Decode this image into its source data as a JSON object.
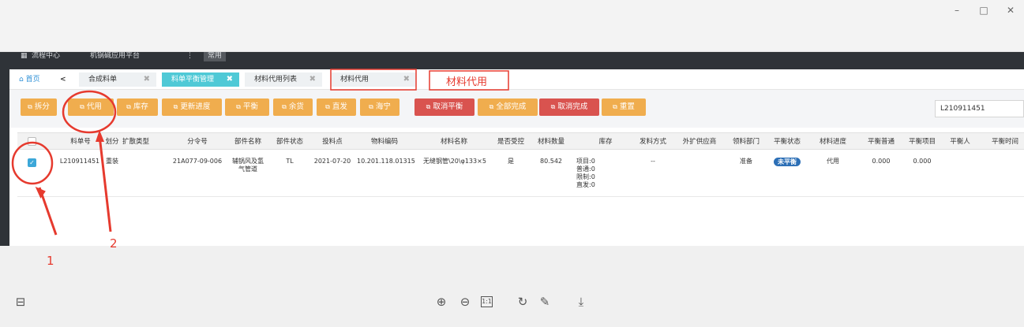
{
  "window_controls": {
    "minimize": "–",
    "maximize": "□",
    "close": "✕"
  },
  "app_bar": {
    "process_center": "流程中心",
    "platform": "机锅碱应用平台",
    "more": "⋮",
    "common": "常用"
  },
  "tabs": {
    "home": "首页",
    "back": "<",
    "items": [
      {
        "label": "合成料单",
        "close": "✖"
      },
      {
        "label": "料单平衡管理",
        "close": "✖"
      },
      {
        "label": "材料代用列表",
        "close": "✖"
      },
      {
        "label": "材料代用",
        "close": "✖"
      }
    ],
    "annotation_label": "材料代用"
  },
  "toolbar": {
    "buttons": [
      {
        "label": "拆分"
      },
      {
        "label": "代用"
      },
      {
        "label": "库存"
      },
      {
        "label": "更新进度"
      },
      {
        "label": "平衡"
      },
      {
        "label": "余货"
      },
      {
        "label": "直发"
      },
      {
        "label": "海宁"
      },
      {
        "label": "取消平衡"
      },
      {
        "label": "全部完成"
      },
      {
        "label": "取消完成"
      },
      {
        "label": "重置"
      }
    ],
    "search_value": "L210911451"
  },
  "table": {
    "headers": [
      "料单号",
      "划分",
      "扩散类型",
      "分令号",
      "部件名称",
      "部件状态",
      "投料点",
      "物料编码",
      "材料名称",
      "是否受控",
      "材料数量",
      "库存",
      "发料方式",
      "外扩供应商",
      "领料部门",
      "平衡状态",
      "材料进度",
      "平衡普通",
      "平衡项目",
      "平衡人",
      "平衡时间"
    ],
    "row": {
      "order_no": "L210911451",
      "division": "重装",
      "diffusion_type": "",
      "sub_order": "21A077-09-006",
      "part_name_1": "辅锅风及氢",
      "part_name_2": "气管道",
      "part_status": "TL",
      "feed_point": "2021-07-20",
      "material_code": "10.201.118.01315",
      "material_name": "无缝钢管\\20\\φ133×5\\",
      "controlled": "是",
      "quantity": "80.542",
      "stock": [
        "项目:0",
        "普通:0",
        "限制:0",
        "直发:0"
      ],
      "issue_method": "--",
      "supplier": "",
      "dept": "准备",
      "balance_status": "未平衡",
      "progress": "代用",
      "bal_normal": "0.000",
      "bal_project": "0.000"
    }
  },
  "annotations": {
    "label_1": "1",
    "label_2": "2",
    "color": "#e63a2e"
  },
  "footer_icons": [
    "layout-icon",
    "zoom-in-icon",
    "zoom-out-icon",
    "actual-size-icon",
    "rotate-icon",
    "edit-icon",
    "download-icon"
  ],
  "footer": {
    "actual_size": "1:1"
  }
}
